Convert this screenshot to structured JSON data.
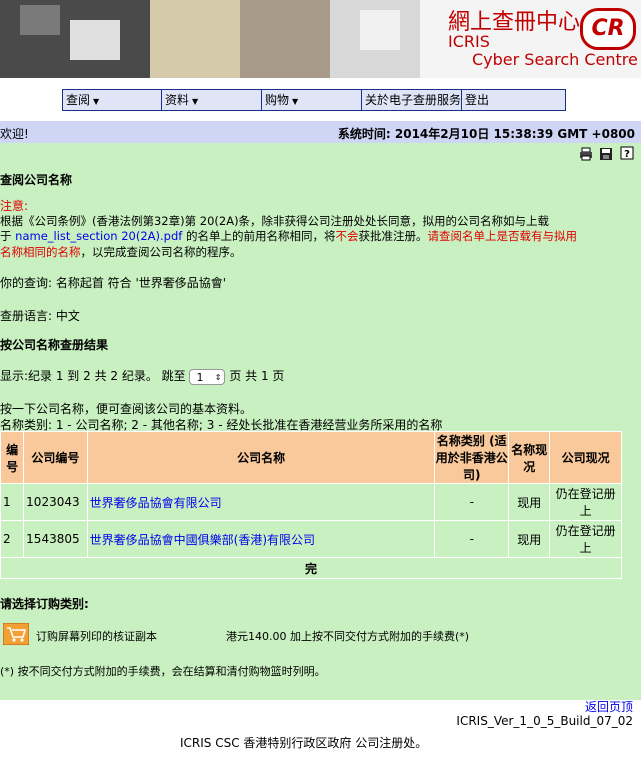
{
  "banner": {
    "title_cn": "網上查冊中心",
    "title_en1": "ICRIS",
    "title_en2": "Cyber Search Centre",
    "logo": "CR"
  },
  "menu": [
    {
      "label": "查阅"
    },
    {
      "label": "资料"
    },
    {
      "label": "购物"
    },
    {
      "label": "关於电子查册服务"
    },
    {
      "label": "登出"
    }
  ],
  "topbar": {
    "welcome": "欢迎!",
    "systime": "系统时间: 2014年2月10日 15:38:39 GMT +0800"
  },
  "page": {
    "heading": "查阅公司名称",
    "notice_label": "注意:",
    "notice_line1": "根据《公司条例》(香港法例第32章)第 20(2A)条，除非获得公司注册处处长同意，拟用的公司名称如与上载",
    "notice_pre": "于",
    "notice_link": "name_list_section 20(2A).pdf",
    "notice_mid": "的名单上的前用名称相同，将",
    "notice_bad": "不会",
    "notice_post": "获批准注册。",
    "notice_red1": "请查阅名单上是否载有与拟用",
    "notice_red2": "名称相同的名称",
    "notice_end": "，以完成查阅公司名称的程序。",
    "query": "你的查询: 名称起首 符合 '世界奢侈品協會'",
    "lang": "查册语言: 中文",
    "results_title": "按公司名称查册结果",
    "record_text": "显示:纪录 1 到 2 共 2 纪录。 跳至",
    "page_select": "1",
    "page_suffix": "页  共 1 页",
    "instr1": "按一下公司名称，便可查阅该公司的基本资料。",
    "instr2": "名称类别: 1 - 公司名称; 2 - 其他名称; 3 - 经处长批准在香港经营业务所采用的名称",
    "order_title": "请选择订购类别:",
    "order_item": "订购屏幕列印的核证副本",
    "order_price": "港元140.00 加上按不同交付方式附加的手续费(*)",
    "footnote": "(*) 按不同交付方式附加的手续费，会在结算和清付购物篮时列明。",
    "back_link": "返回页顶"
  },
  "table": {
    "headers": [
      "编号",
      "公司编号",
      "公司名称",
      "名称类别 (适用於非香港公司)",
      "名称现况",
      "公司现况"
    ],
    "rows": [
      [
        "1",
        "1023043",
        "世界奢侈品協會有限公司",
        "-",
        "现用",
        "仍在登记册上"
      ],
      [
        "2",
        "1543805",
        "世界奢侈品協會中國俱樂部(香港)有限公司",
        "-",
        "现用",
        "仍在登记册上"
      ]
    ],
    "end": "完"
  },
  "footer": {
    "build": "ICRIS_Ver_1_0_5_Build_07_02",
    "org": "ICRIS CSC 香港特别行政区政府 公司注册处。"
  }
}
